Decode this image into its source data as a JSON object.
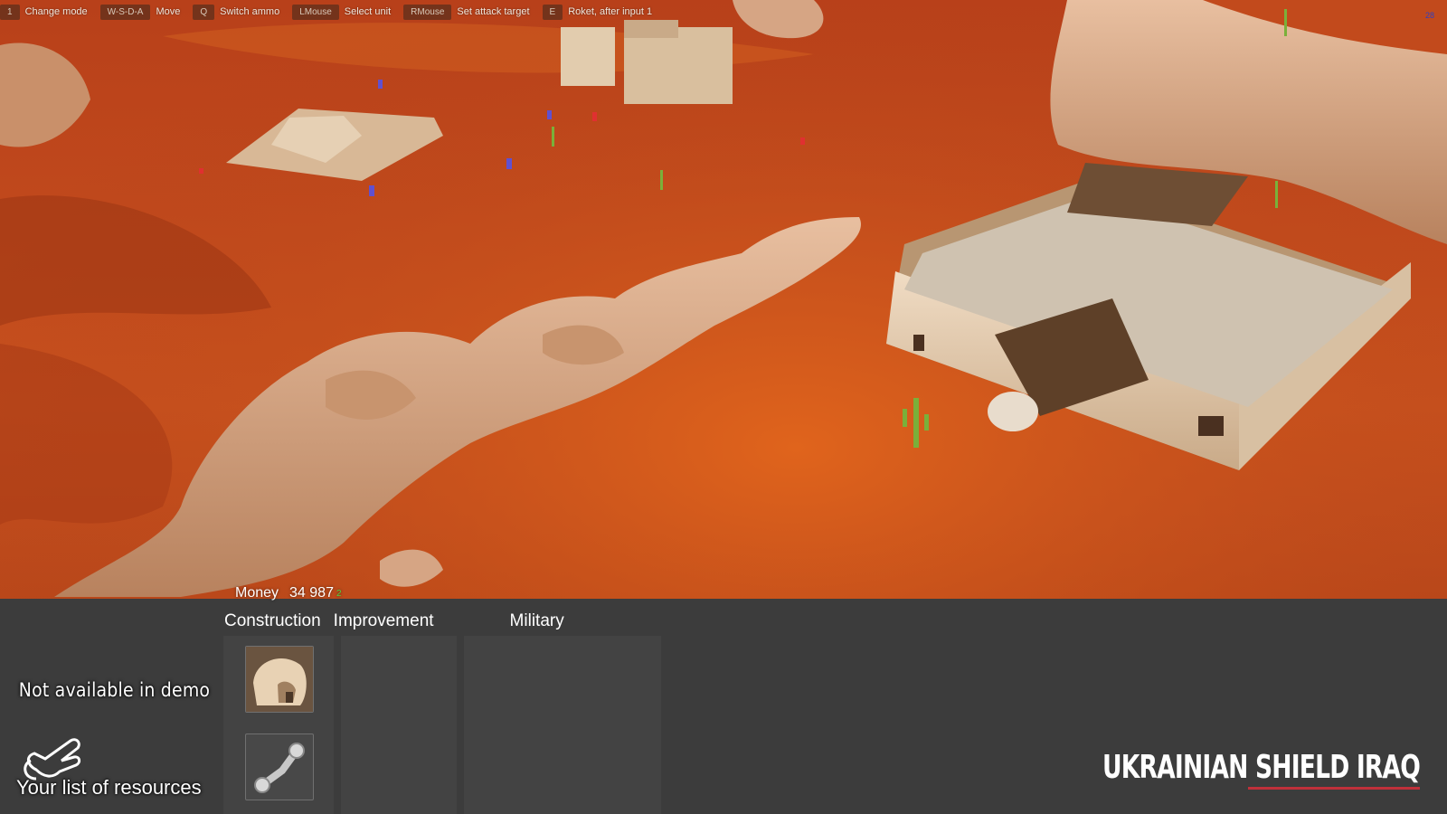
{
  "hotkeys": [
    {
      "key": "1",
      "label": "Change mode"
    },
    {
      "key": "W-S-D-A",
      "label": "Move"
    },
    {
      "key": "Q",
      "label": "Switch ammo"
    },
    {
      "key": "LMouse",
      "label": "Select unit"
    },
    {
      "key": "RMouse",
      "label": "Set attack target"
    },
    {
      "key": "E",
      "label": "Roket, after input 1"
    }
  ],
  "fps": "28",
  "money": {
    "label": "Money",
    "value": "34 987",
    "delta": "2"
  },
  "minimap": {
    "note": "Not available in demo",
    "caption": "Your list of resources"
  },
  "tabs": {
    "construction": "Construction",
    "improvement": "Improvement",
    "military": "Military"
  },
  "logo": {
    "text": "UKRAINIAN SHIELD IRAQ"
  },
  "colors": {
    "sand": "#c4521f",
    "panel": "#3c3c3c",
    "accent": "#c0303a"
  },
  "icons": {
    "item1": "adobe-house-icon",
    "item2": "pipe-joint-icon"
  }
}
